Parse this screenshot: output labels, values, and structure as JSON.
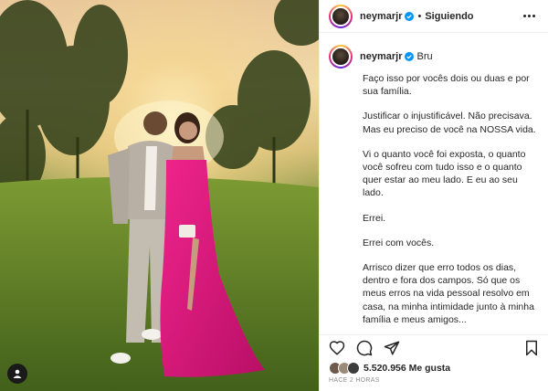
{
  "post": {
    "username": "neymarjr",
    "follow_status": "Siguiendo",
    "separator": "•",
    "caption_title": "Bru",
    "caption_paragraphs": [
      "Faço isso por vocês dois ou duas e por sua família.",
      "Justificar o injustificável. Não precisava. Mas eu preciso de você na NOSSA vida.",
      "Vi o quanto você foi exposta, o quanto você sofreu com tudo isso e o quanto quer estar ao meu lado. E eu ao seu lado.",
      "Errei.",
      "Errei com vocês.",
      "Arrisco dizer que erro todos os dias, dentro e fora dos campos. Só que os meus erros na vida pessoal resolvo em casa, na minha intimidade junto à minha família e meus amigos..."
    ],
    "likes_count": "5.520.956 Me gusta",
    "time_ago": "HACE 2 HORAS"
  },
  "icons": {
    "verified": "verified-badge-icon",
    "more": "more-options-icon",
    "like": "heart-icon",
    "comment": "comment-icon",
    "share": "send-icon",
    "save": "bookmark-icon",
    "tagged_user": "user-tag-icon"
  },
  "colors": {
    "verified_blue": "#0095f6",
    "dress_pink": "#e0157e",
    "text": "#262626",
    "muted": "#8e8e8e"
  }
}
